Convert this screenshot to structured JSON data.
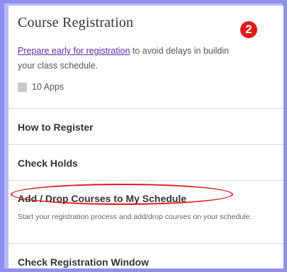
{
  "header": {
    "title": "Course Registration",
    "badge": "2",
    "link_text": "Prepare early for registration",
    "desc_rest_line1": " to avoid delays in buildin",
    "desc_line2": "your class schedule.",
    "apps_label": "10 Apps"
  },
  "items": [
    {
      "label": "How to Register"
    },
    {
      "label": "Check Holds"
    },
    {
      "label": "Add / Drop Courses to My Schedule",
      "description": "Start your registration process and add/drop courses on your schedule."
    },
    {
      "label": "Check Registration Window"
    }
  ],
  "colors": {
    "accent": "#e11a1a",
    "link": "#5b2aa6",
    "background": "#8f8ff0"
  }
}
